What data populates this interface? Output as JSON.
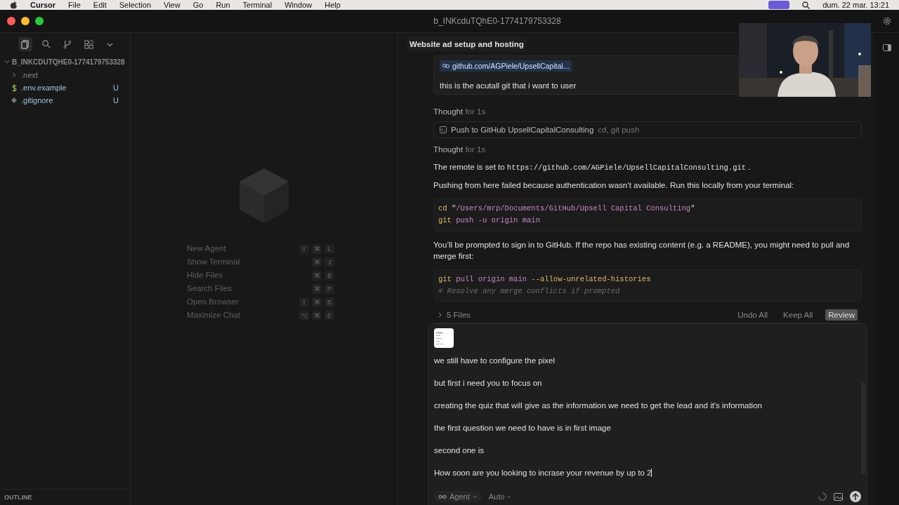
{
  "menu_bar": {
    "app": "Cursor",
    "items": [
      "File",
      "Edit",
      "Selection",
      "View",
      "Go",
      "Run",
      "Terminal",
      "Window",
      "Help"
    ],
    "clock": "dum. 22 mar. 13:21"
  },
  "window": {
    "title": "b_INKcduTQhE0-1774179753328"
  },
  "sidebar": {
    "folder": "B_INKCDUTQHE0-1774179753328",
    "items": [
      {
        "name": ".next",
        "kind": "folder"
      },
      {
        "name": ".env.example",
        "kind": "env",
        "status": "U"
      },
      {
        "name": ".gitignore",
        "kind": "git",
        "status": "U"
      }
    ],
    "outline": "OUTLINE"
  },
  "welcome": {
    "shortcuts": [
      {
        "label": "New Agent",
        "keys": [
          "⇧",
          "⌘",
          "L"
        ]
      },
      {
        "label": "Show Terminal",
        "keys": [
          "⌘",
          "J"
        ]
      },
      {
        "label": "Hide Files",
        "keys": [
          "⌘",
          "B"
        ]
      },
      {
        "label": "Search Files",
        "keys": [
          "⌘",
          "P"
        ]
      },
      {
        "label": "Open Browser",
        "keys": [
          "⇧",
          "⌘",
          "B"
        ]
      },
      {
        "label": "Maximize Chat",
        "keys": [
          "⌥",
          "⌘",
          "E"
        ]
      }
    ]
  },
  "chat": {
    "tab_title": "Website ad setup and hosting",
    "pinned": {
      "link": "github.com/AGPiele/UpsellCapital...",
      "text": "this is the acutall git that i want to user"
    },
    "messages": [
      {
        "kind": "thought",
        "label": "Thought",
        "detail": "for 1s"
      },
      {
        "kind": "tool",
        "title": "Push to GitHub UpsellCapitalConsulting",
        "detail": "cd, git push"
      },
      {
        "kind": "thought",
        "label": "Thought",
        "detail": "for 1s"
      },
      {
        "kind": "text",
        "parts": [
          {
            "text": "The remote is set to ",
            "code": false
          },
          {
            "text": "https://github.com/AGPiele/UpsellCapitalConsulting.git",
            "code": true
          },
          {
            "text": " .",
            "code": false
          }
        ]
      },
      {
        "kind": "text",
        "parts": [
          {
            "text": "Pushing from here failed because authentication wasn’t available. Run this locally from your terminal:",
            "code": false
          }
        ]
      },
      {
        "kind": "code",
        "lines": [
          [
            {
              "text": "cd",
              "kind": "command"
            },
            {
              "text": " \"",
              "kind": "plain"
            },
            {
              "text": "/Users/mrp/Documents/GitHub/Upsell Capital Consulting",
              "kind": "string"
            },
            {
              "text": "\"",
              "kind": "plain"
            }
          ],
          [
            {
              "text": "git",
              "kind": "command"
            },
            {
              "text": " push -u origin main",
              "kind": "argument"
            }
          ]
        ]
      },
      {
        "kind": "text",
        "parts": [
          {
            "text": "You’ll be prompted to sign in to GitHub. If the repo has existing content (e.g. a README), you might need to pull and merge first:",
            "code": false
          }
        ]
      },
      {
        "kind": "code",
        "lines": [
          [
            {
              "text": "git",
              "kind": "command"
            },
            {
              "text": " pull origin main ",
              "kind": "argument"
            },
            {
              "text": "--allow-unrelated-histories",
              "kind": "flag"
            }
          ],
          [
            {
              "text": "# Resolve any merge conflicts if prompted",
              "kind": "comment"
            }
          ]
        ]
      }
    ],
    "files_bar": {
      "toggle": "5 Files",
      "buttons": [
        {
          "label": "Undo All",
          "selected": false
        },
        {
          "label": "Keep All",
          "selected": false
        },
        {
          "label": "Review",
          "selected": true
        }
      ]
    }
  },
  "composer": {
    "lines": [
      "we still have to configure the pixel",
      "but first i need you to focus on",
      "creating the quiz that will give as the information we need to get the lead and it's information",
      "the first question we need to have is in first image",
      "second one is",
      "How soon are you looking to incrase your revenue by up to 2"
    ],
    "mode": "Agent",
    "model": "Auto"
  }
}
